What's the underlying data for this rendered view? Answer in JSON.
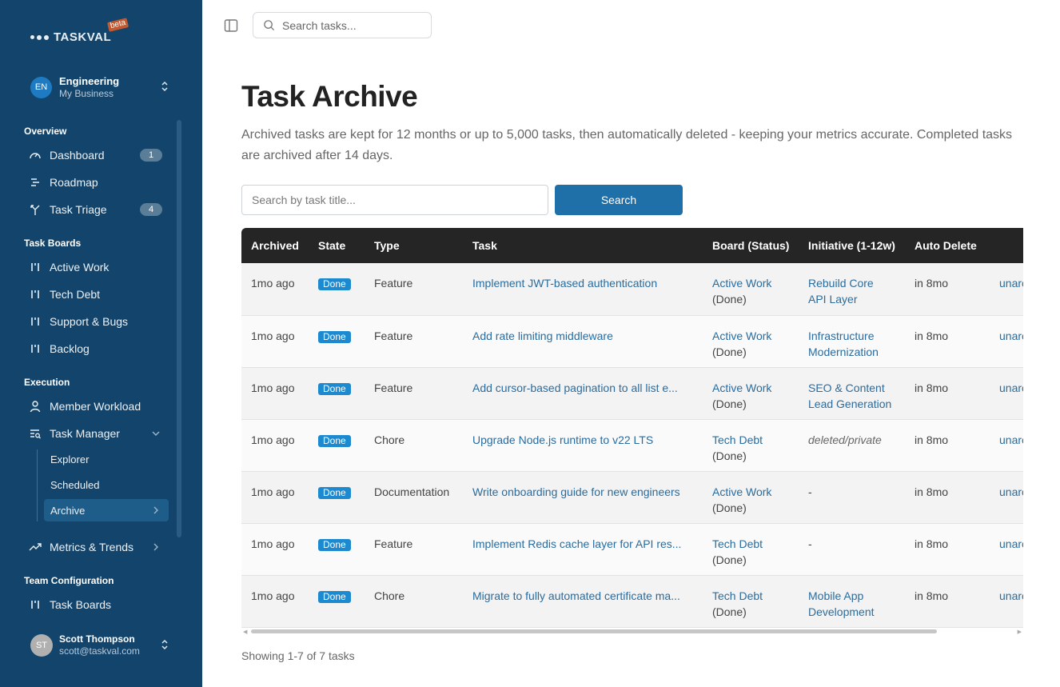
{
  "app": {
    "logo": "TASKVAL",
    "beta": "beta"
  },
  "workspace": {
    "initials": "EN",
    "name": "Engineering",
    "sub": "My Business"
  },
  "sidebar": {
    "overview_label": "Overview",
    "overview": [
      {
        "label": "Dashboard",
        "badge": "1"
      },
      {
        "label": "Roadmap"
      },
      {
        "label": "Task Triage",
        "badge": "4"
      }
    ],
    "boards_label": "Task Boards",
    "boards": [
      {
        "label": "Active Work"
      },
      {
        "label": "Tech Debt"
      },
      {
        "label": "Support & Bugs"
      },
      {
        "label": "Backlog"
      }
    ],
    "execution_label": "Execution",
    "execution": [
      {
        "label": "Member Workload"
      },
      {
        "label": "Task Manager"
      }
    ],
    "task_manager_sub": [
      {
        "label": "Explorer"
      },
      {
        "label": "Scheduled"
      },
      {
        "label": "Archive"
      }
    ],
    "metrics": {
      "label": "Metrics & Trends"
    },
    "team_label": "Team Configuration",
    "team": [
      {
        "label": "Task Boards"
      }
    ]
  },
  "user": {
    "initials": "ST",
    "name": "Scott Thompson",
    "email": "scott@taskval.com"
  },
  "topbar": {
    "search_placeholder": "Search tasks..."
  },
  "main": {
    "title": "Task Archive",
    "description": "Archived tasks are kept for 12 months or up to 5,000 tasks, then automatically deleted - keeping your metrics accurate. Completed tasks are archived after 14 days.",
    "search_placeholder": "Search by task title...",
    "search_button": "Search",
    "columns": [
      "Archived",
      "State",
      "Type",
      "Task",
      "Board (Status)",
      "Initiative (1-12w)",
      "Auto Delete",
      ""
    ],
    "rows": [
      {
        "archived": "1mo ago",
        "state": "Done",
        "type": "Feature",
        "task": "Implement JWT-based authentication",
        "board": "Active Work",
        "board_status": "(Done)",
        "initiative1": "Rebuild Core",
        "initiative2": "API Layer",
        "auto_delete": "in 8mo",
        "action": "unarc"
      },
      {
        "archived": "1mo ago",
        "state": "Done",
        "type": "Feature",
        "task": "Add rate limiting middleware",
        "board": "Active Work",
        "board_status": "(Done)",
        "initiative1": "Infrastructure",
        "initiative2": "Modernization",
        "auto_delete": "in 8mo",
        "action": "unarc"
      },
      {
        "archived": "1mo ago",
        "state": "Done",
        "type": "Feature",
        "task": "Add cursor-based pagination to all list e...",
        "board": "Active Work",
        "board_status": "(Done)",
        "initiative1": "SEO & Content",
        "initiative2": "Lead Generation",
        "auto_delete": "in 8mo",
        "action": "unarc"
      },
      {
        "archived": "1mo ago",
        "state": "Done",
        "type": "Chore",
        "task": "Upgrade Node.js runtime to v22 LTS",
        "board": "Tech Debt",
        "board_status": "(Done)",
        "initiative_italic": "deleted/private",
        "auto_delete": "in 8mo",
        "action": "unarc"
      },
      {
        "archived": "1mo ago",
        "state": "Done",
        "type": "Documentation",
        "task": "Write onboarding guide for new engineers",
        "board": "Active Work",
        "board_status": "(Done)",
        "initiative_plain": "-",
        "auto_delete": "in 8mo",
        "action": "unarc"
      },
      {
        "archived": "1mo ago",
        "state": "Done",
        "type": "Feature",
        "task": "Implement Redis cache layer for API res...",
        "board": "Tech Debt",
        "board_status": "(Done)",
        "initiative_plain": "-",
        "auto_delete": "in 8mo",
        "action": "unarc"
      },
      {
        "archived": "1mo ago",
        "state": "Done",
        "type": "Chore",
        "task": "Migrate to fully automated certificate ma...",
        "board": "Tech Debt",
        "board_status": "(Done)",
        "initiative1": "Mobile App",
        "initiative2": "Development",
        "auto_delete": "in 8mo",
        "action": "unarc"
      }
    ],
    "footer": "Showing 1-7 of 7 tasks"
  },
  "colors": {
    "sidebar_bg": "#13456c",
    "accent": "#1f6fa8",
    "badge_done": "#1d8ad0",
    "table_header": "#252525"
  }
}
